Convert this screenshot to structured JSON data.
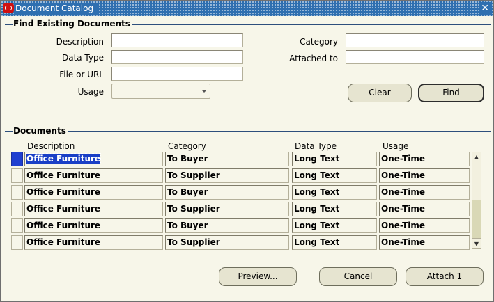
{
  "window": {
    "title": "Document Catalog",
    "close_symbol": "✕"
  },
  "find": {
    "section_title": "Find Existing Documents",
    "description_label": "Description",
    "data_type_label": "Data Type",
    "file_url_label": "File or URL",
    "usage_label": "Usage",
    "category_label": "Category",
    "attached_to_label": "Attached to",
    "description_value": "",
    "data_type_value": "",
    "file_url_value": "",
    "usage_value": "",
    "category_value": "",
    "attached_to_value": "",
    "clear_label": "Clear",
    "find_label": "Find"
  },
  "documents": {
    "section_title": "Documents",
    "columns": [
      "Description",
      "Category",
      "Data Type",
      "Usage"
    ],
    "rows": [
      {
        "description": "Office Furniture",
        "category": "To Buyer",
        "data_type": "Long Text",
        "usage": "One-Time"
      },
      {
        "description": "Office Furniture",
        "category": "To Supplier",
        "data_type": "Long Text",
        "usage": "One-Time"
      },
      {
        "description": "Office Furniture",
        "category": "To Buyer",
        "data_type": "Long Text",
        "usage": "One-Time"
      },
      {
        "description": "Office Furniture",
        "category": "To Supplier",
        "data_type": "Long Text",
        "usage": "One-Time"
      },
      {
        "description": "Office Furniture",
        "category": "To Buyer",
        "data_type": "Long Text",
        "usage": "One-Time"
      },
      {
        "description": "Office Furniture",
        "category": "To Supplier",
        "data_type": "Long Text",
        "usage": "One-Time"
      }
    ]
  },
  "footer": {
    "preview_label": "Preview...",
    "cancel_label": "Cancel",
    "attach_label": "Attach 1"
  },
  "colors": {
    "titlebar": "#2e6fb0",
    "background": "#f7f6e9",
    "selection": "#1a3fc6"
  }
}
